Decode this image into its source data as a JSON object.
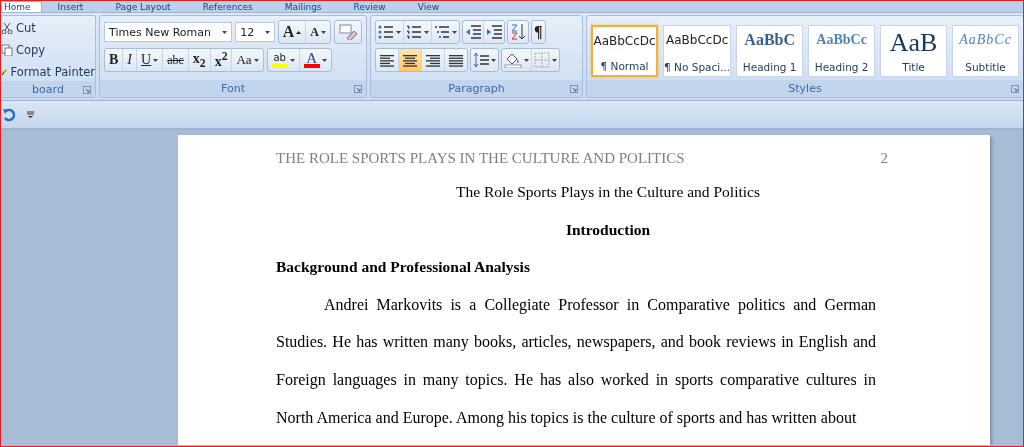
{
  "tabs": [
    {
      "label": "Home",
      "selected": true
    },
    {
      "label": "Insert",
      "selected": false
    },
    {
      "label": "Page Layout",
      "selected": false
    },
    {
      "label": "References",
      "selected": false
    },
    {
      "label": "Mailings",
      "selected": false
    },
    {
      "label": "Review",
      "selected": false
    },
    {
      "label": "View",
      "selected": false
    }
  ],
  "clipboard": {
    "label": "board",
    "items": [
      {
        "kind": "cut",
        "label": "Cut"
      },
      {
        "kind": "copy",
        "label": "Copy"
      },
      {
        "kind": "painter",
        "label": "Format Painter"
      }
    ]
  },
  "font": {
    "label": "Font",
    "name": "Times New Roman",
    "size": "12",
    "grow": "A",
    "shrink": "A",
    "buttons": [
      {
        "kind": "bold",
        "text": "B",
        "dropdown": false
      },
      {
        "kind": "italic",
        "text": "I",
        "dropdown": false
      },
      {
        "kind": "underline",
        "text": "U",
        "dropdown": true
      },
      {
        "kind": "strike",
        "text": "abc",
        "dropdown": false
      },
      {
        "kind": "sub",
        "text": "x$_{2}$",
        "dropdown": false
      },
      {
        "kind": "sup",
        "text": "x$^{2}$",
        "dropdown": false
      },
      {
        "kind": "case",
        "text": "Aa",
        "dropdown": true
      }
    ],
    "colors": [
      {
        "kind": "highlight",
        "text": "ab",
        "color": "#ffff00"
      },
      {
        "kind": "fontcolor",
        "text": "A",
        "color": "#ff0000"
      }
    ]
  },
  "paragraph": {
    "label": "Paragraph",
    "show_marks": "¶",
    "align": [
      {
        "kind": "left",
        "selected": false
      },
      {
        "kind": "center",
        "selected": true
      },
      {
        "kind": "right",
        "selected": false
      },
      {
        "kind": "justify",
        "selected": false
      }
    ]
  },
  "styles": {
    "label": "Styles",
    "items": [
      {
        "kind": "normal",
        "preview": "AaBbCcDc",
        "label": "¶ Normal",
        "selected": true
      },
      {
        "kind": "normal",
        "preview": "AaBbCcDc",
        "label": "¶ No Spaci...",
        "selected": false
      },
      {
        "kind": "heading1",
        "preview": "AaBbC",
        "label": "Heading 1",
        "selected": false
      },
      {
        "kind": "heading2",
        "preview": "AaBbCc",
        "label": "Heading 2",
        "selected": false
      },
      {
        "kind": "title",
        "preview": "AaB",
        "label": "Title",
        "selected": false
      },
      {
        "kind": "subtitle",
        "preview": "AaBbCc",
        "label": "Subtitle",
        "selected": false
      }
    ]
  },
  "document": {
    "header": "THE ROLE SPORTS PLAYS IN THE CULTURE AND POLITICS",
    "page_number": "2",
    "title": "The Role Sports Plays in the Culture and Politics",
    "heading": "Introduction",
    "subheading": "Background and Professional Analysis",
    "paragraph": "Andrei Markovits is a Collegiate Professor in Comparative politics and German Studies. He has written many books, articles, newspapers, and book reviews in English and Foreign languages in many topics. He has also worked in sports comparative cultures in North America and Europe. Among his topics is the culture of sports and has written about"
  }
}
